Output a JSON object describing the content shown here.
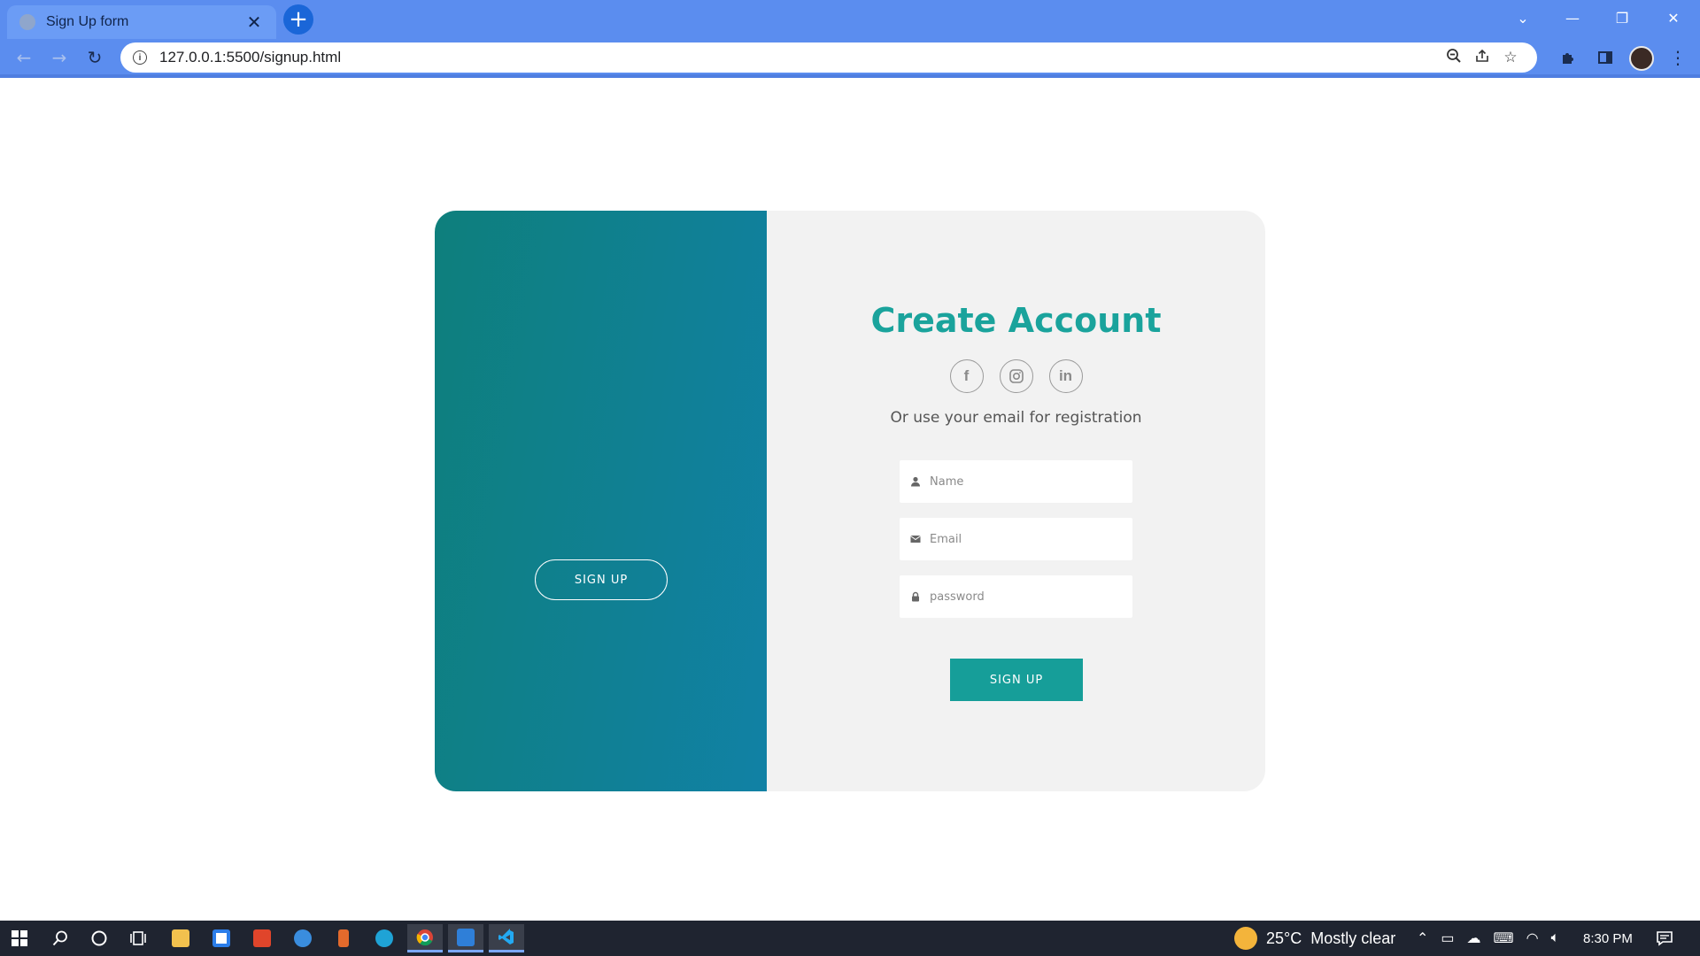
{
  "browser": {
    "tab_title": "Sign Up form",
    "tab_close": "✕",
    "new_tab": "+",
    "url": "127.0.0.1:5500/signup.html",
    "window_controls": {
      "tabs_dropdown": "⌄",
      "minimize": "—",
      "restore": "❐",
      "close": "✕"
    }
  },
  "page": {
    "left_panel": {
      "button_label": "SIGN UP"
    },
    "heading": "Create Account",
    "social": {
      "facebook": "f",
      "instagram": "instagram-icon",
      "linkedin": "in"
    },
    "subtext": "Or use your email for registration",
    "fields": {
      "name_placeholder": "Name",
      "email_placeholder": "Email",
      "password_placeholder": "password"
    },
    "submit_label": "SIGN UP",
    "colors": {
      "accent": "#1aa39c",
      "panel_gradient_start": "#0e7f7c",
      "panel_gradient_end": "#1181a5",
      "card_bg": "#f2f2f2"
    }
  },
  "taskbar": {
    "weather_temp": "25°C",
    "weather_text": "Mostly clear",
    "time": "8:30 PM"
  }
}
